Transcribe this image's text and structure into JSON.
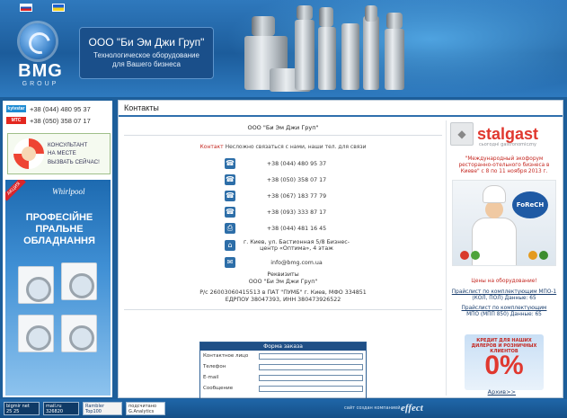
{
  "header": {
    "logo_text": "BMG",
    "logo_sub": "GROUP",
    "company_name": "ООО \"Би Эм Джи Груп\"",
    "company_tagline_1": "Технологическое оборудование",
    "company_tagline_2": "для Вашего бизнеса"
  },
  "left": {
    "phones": [
      {
        "operator": "kyivstar",
        "number": "+38 (044) 480 95 37"
      },
      {
        "operator": "МТС",
        "number": "+38 (050) 358 07 17"
      }
    ],
    "consult_line1": "КОНСУЛЬТАНТ",
    "consult_line2": "НА МЕСТЕ",
    "consult_button": "ВЫЗВАТЬ СЕЙЧАС!",
    "ad": {
      "ribbon": "АКЦИЯ",
      "brand": "Whirlpool",
      "title": "ПРОФЕСІЙНЕ ПРАЛЬНЕ ОБЛАДНАННЯ"
    }
  },
  "main": {
    "tab_label": "Контакты",
    "company": "ООО \"Би Эм Джи Груп\"",
    "intro_highlight": "Контакт",
    "intro_rest": " Несложно связаться с нами, наши тел. для связи",
    "contacts": [
      {
        "icon": "phone",
        "text": "+38 (044) 480 95 37"
      },
      {
        "icon": "phone",
        "text": "+38 (050) 358 07 17"
      },
      {
        "icon": "phone",
        "text": "+38 (067) 183 77 79"
      },
      {
        "icon": "phone",
        "text": "+38 (093) 333 87 17"
      },
      {
        "icon": "fax",
        "text": "+38 (044) 481 16 45"
      },
      {
        "icon": "home",
        "text": "г. Киев, ул. Бастионная 5/8 Бизнес-центр «Оптима», 4 этаж"
      },
      {
        "icon": "mail",
        "text": "info@bmg.com.ua"
      }
    ],
    "bank_line1": "Реквизиты",
    "bank_line2": "ООО \"Би Эм Джи Груп\"",
    "bank_line3": "Р/с 26003060415513 в ПАТ \"ПУМБ\" г. Киев, МФО 334851",
    "bank_line4": "ЕДРПОУ 38047393, ИНН 380473926522",
    "form": {
      "title": "Форма заказа",
      "fields": [
        "Контактное лицо",
        "Телефон",
        "E-mail",
        "Сообщение"
      ]
    }
  },
  "right": {
    "brand": "stalgast",
    "brand_sub": "сьогодні gastronomiczny",
    "forum_text": "\"Международный экофорум ресторанно-отельного бизнеса в Киеве\" с 8 по 11 ноября 2013 г.",
    "forum_badge": "FoReCH",
    "green_text": "Цены на оборудование!",
    "link1_a": "Прайслист по комплектующим МПО-1",
    "link1_b": "(КОЛ, ПОЛ) Данные: 65",
    "link2_a": "Прайслист по комплектующим",
    "link2_b": "МПО (МПП 850) Данные: 65",
    "promo_text": "КРЕДИТ ДЛЯ НАШИХ ДИЛЕРОВ И РОЗНИЧНЫХ КЛИЕНТОВ",
    "promo_value": "0%",
    "archive": "Архив>>"
  },
  "footer": {
    "badge1": "bigmir net",
    "badge1_sub": "25   25",
    "badge2": "mail.ru",
    "badge2_sub": "326820",
    "badge3": "Rambler Top100",
    "badge4": "подсчитано G.Analytics",
    "credit": "сайт создан компанией",
    "effect": "effect"
  },
  "colors": {
    "header_blue": "#1d5e9a",
    "accent_red": "#c4261f",
    "stalgast_red": "#e0382f",
    "link_blue": "#1b3f6e"
  }
}
